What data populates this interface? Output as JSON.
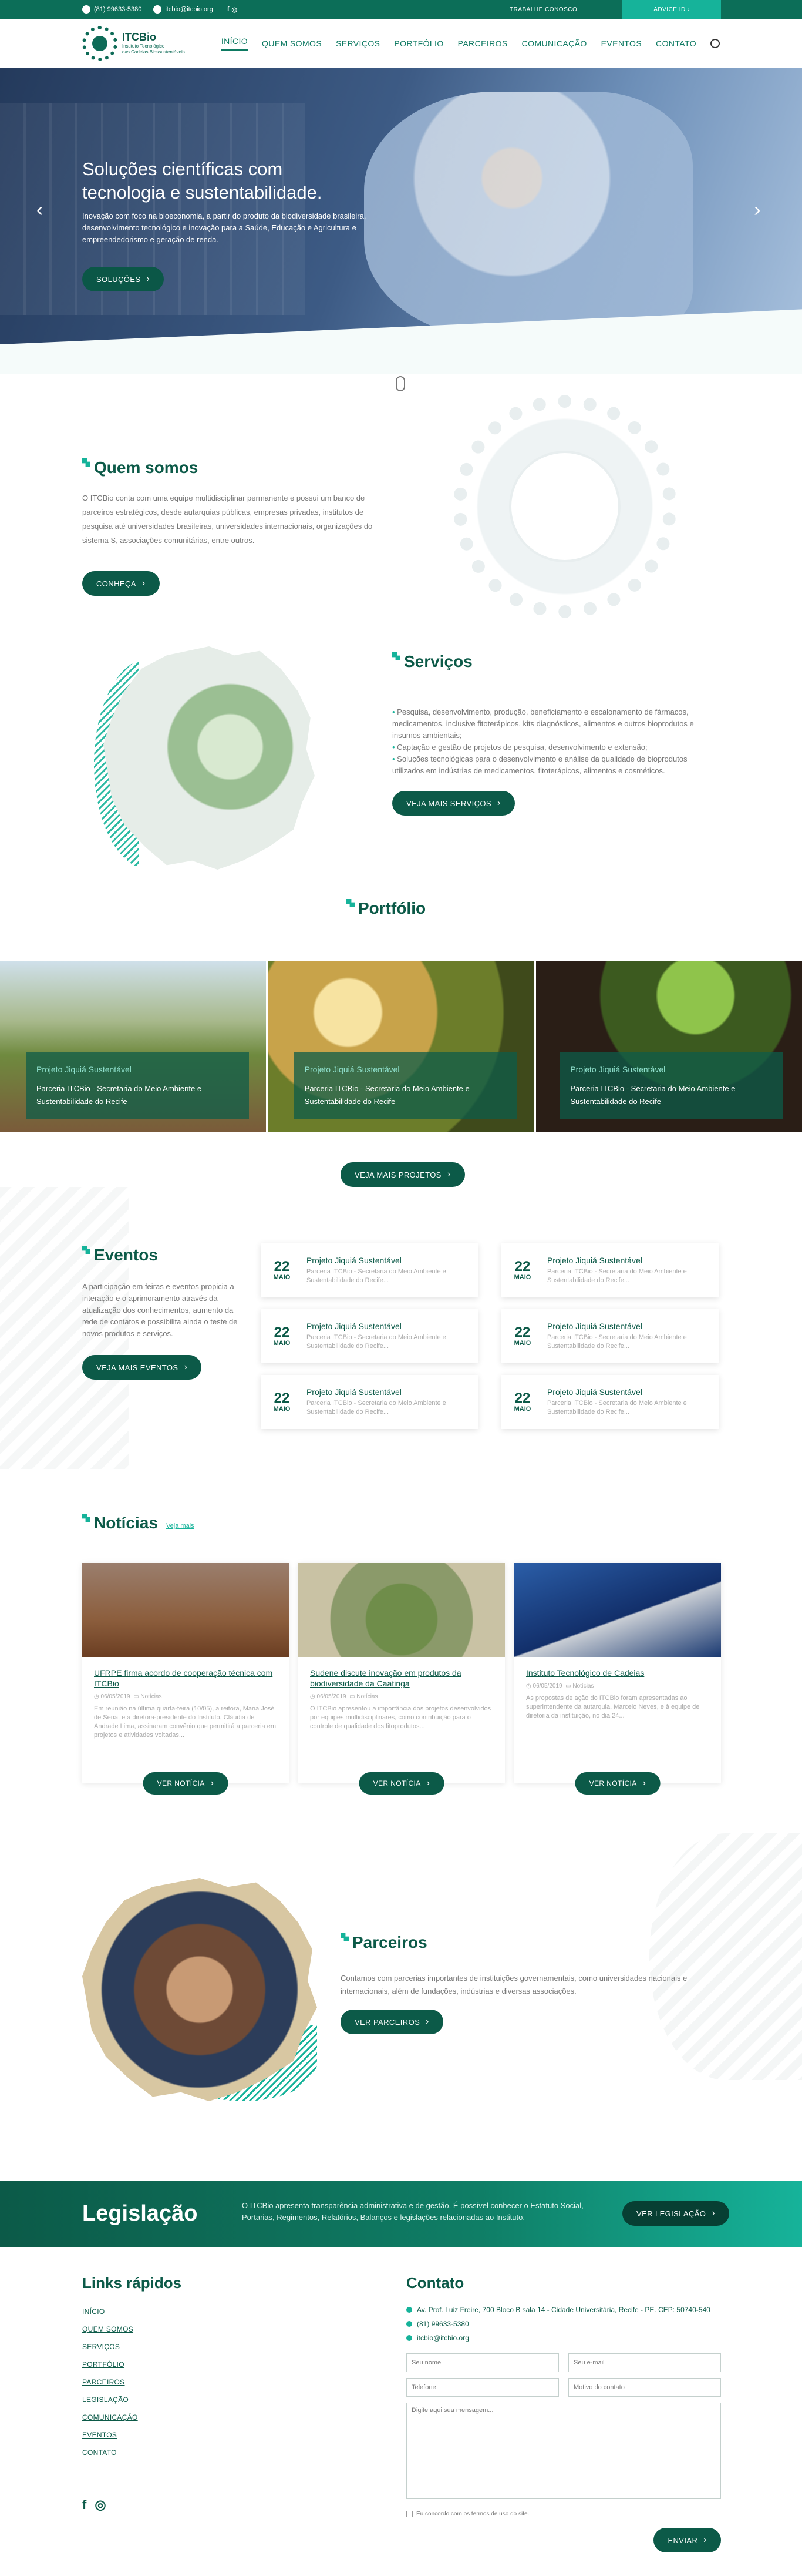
{
  "topbar": {
    "phone": "(81) 99633-5380",
    "email": "itcbio@itcbio.org",
    "work_with_us": "TRABALHE CONOSCO",
    "advice": "ADVICE ID ›"
  },
  "brand": {
    "name": "ITCBio",
    "tagline_1": "Instituto Tecnológico",
    "tagline_2": "das Cadeias Biossustentáveis"
  },
  "nav": {
    "items": [
      "INÍCIO",
      "QUEM SOMOS",
      "SERVIÇOS",
      "PORTFÓLIO",
      "PARCEIROS",
      "COMUNICAÇÃO",
      "EVENTOS",
      "CONTATO"
    ],
    "active": 0
  },
  "hero": {
    "title": "Soluções científicas com tecnologia e sustentabilidade.",
    "text": "Inovação com foco na bioeconomia, a partir do produto da biodiversidade brasileira, desenvolvimento tecnológico e inovação para a Saúde, Educação e Agricultura e empreendedorismo e geração de renda.",
    "button": "SOLUÇÕES"
  },
  "about": {
    "title": "Quem somos",
    "text": "O ITCBio conta com uma equipe multidisciplinar permanente e possui um banco de parceiros estratégicos, desde autarquias públicas, empresas privadas, institutos de pesquisa até universidades brasileiras, universidades internacionais, organizações do sistema S, associações comunitárias, entre outros.",
    "button": "CONHEÇA"
  },
  "services": {
    "title": "Serviços",
    "items": [
      "Pesquisa, desenvolvimento, produção, beneficiamento e escalonamento de fármacos, medicamentos, inclusive fitoterápicos, kits diagnósticos, alimentos e outros bioprodutos e insumos ambientais;",
      "Captação e gestão de projetos de pesquisa, desenvolvimento e extensão;",
      "Soluções tecnológicas para o desenvolvimento e análise da qualidade de bioprodutos utilizados em indústrias de medicamentos, fitoterápicos, alimentos e cosméticos."
    ],
    "button": "VEJA MAIS SERVIÇOS"
  },
  "portfolio": {
    "title": "Portfólio",
    "items": [
      {
        "title": "Projeto Jiquiá Sustentável",
        "text": "Parceria ITCBio - Secretaria do Meio Ambiente e Sustentabilidade do Recife"
      },
      {
        "title": "Projeto Jiquiá Sustentável",
        "text": "Parceria ITCBio - Secretaria do Meio Ambiente e Sustentabilidade do Recife"
      },
      {
        "title": "Projeto Jiquiá Sustentável",
        "text": "Parceria ITCBio - Secretaria do Meio Ambiente e Sustentabilidade do Recife"
      }
    ],
    "button": "VEJA MAIS PROJETOS"
  },
  "events": {
    "title": "Eventos",
    "text": "A participação em feiras e eventos propicia a interação e o aprimoramento através da atualização dos conhecimentos, aumento da rede de contatos e possibilita ainda o teste de novos produtos e serviços.",
    "button": "VEJA MAIS EVENTOS",
    "items": [
      {
        "day": "22",
        "month": "MAIO",
        "title": "Projeto Jiquiá Sustentável",
        "text": "Parceria ITCBio - Secretaria do Meio Ambiente e Sustentabilidade do Recife..."
      },
      {
        "day": "22",
        "month": "MAIO",
        "title": "Projeto Jiquiá Sustentável",
        "text": "Parceria ITCBio - Secretaria do Meio Ambiente e Sustentabilidade do Recife..."
      },
      {
        "day": "22",
        "month": "MAIO",
        "title": "Projeto Jiquiá Sustentável",
        "text": "Parceria ITCBio - Secretaria do Meio Ambiente e Sustentabilidade do Recife..."
      },
      {
        "day": "22",
        "month": "MAIO",
        "title": "Projeto Jiquiá Sustentável",
        "text": "Parceria ITCBio - Secretaria do Meio Ambiente e Sustentabilidade do Recife..."
      },
      {
        "day": "22",
        "month": "MAIO",
        "title": "Projeto Jiquiá Sustentável",
        "text": "Parceria ITCBio - Secretaria do Meio Ambiente e Sustentabilidade do Recife..."
      },
      {
        "day": "22",
        "month": "MAIO",
        "title": "Projeto Jiquiá Sustentável",
        "text": "Parceria ITCBio - Secretaria do Meio Ambiente e Sustentabilidade do Recife..."
      }
    ]
  },
  "news": {
    "title": "Notícias",
    "more": "Veja mais",
    "button": "VER NOTÍCIA",
    "items": [
      {
        "title": "UFRPE firma acordo de cooperação técnica com ITCBio",
        "date": "06/05/2019",
        "category": "Notícias",
        "text": "Em reunião na última quarta-feira (10/05), a reitora, Maria José de Sena, e a diretora-presidente do Instituto, Cláudia de Andrade Lima, assinaram convênio que permitirá a parceria em projetos e atividades voltadas..."
      },
      {
        "title": "Sudene discute inovação em produtos da biodiversidade da Caatinga",
        "date": "06/05/2019",
        "category": "Notícias",
        "text": "O ITCBio apresentou a importância dos projetos desenvolvidos por equipes multidisciplinares, como contribuição para o controle de qualidade dos fitoprodutos..."
      },
      {
        "title": "Instituto Tecnológico de Cadeias",
        "date": "06/05/2019",
        "category": "Notícias",
        "text": "As propostas de ação do ITCBio foram apresentadas ao superintendente da autarquia, Marcelo Neves, e à equipe de diretoria da instituição, no dia 24..."
      }
    ]
  },
  "partners": {
    "title": "Parceiros",
    "text": "Contamos com parcerias importantes de instituições governamentais, como universidades nacionais e internacionais, além de fundações, indústrias e diversas associações.",
    "button": "VER PARCEIROS"
  },
  "legislation": {
    "title": "Legislação",
    "text": "O ITCBio apresenta transparência administrativa e de gestão. É possível conhecer o Estatuto Social, Portarias, Regimentos, Relatórios, Balanços e legislações relacionadas ao Instituto.",
    "button": "VER LEGISLAÇÃO"
  },
  "quick_links": {
    "title": "Links rápidos",
    "items": [
      "INÍCIO",
      "QUEM SOMOS",
      "SERVIÇOS",
      "PORTFÓLIO",
      "PARCEIROS",
      "LEGISLAÇÃO",
      "COMUNICAÇÃO",
      "EVENTOS",
      "CONTATO"
    ]
  },
  "contact": {
    "title": "Contato",
    "address": "Av. Prof. Luiz Freire, 700 Bloco B sala 14 - Cidade Universitária, Recife - PE. CEP: 50740-540",
    "phone": "(81) 99633-5380",
    "email": "itcbio@itcbio.org",
    "ph_name": "Seu nome",
    "ph_email": "Seu e-mail",
    "ph_phone": "Telefone",
    "ph_reason": "Motivo do contato",
    "ph_message": "Digite aqui sua mensagem...",
    "terms": "Eu concordo com os termos de uso do site.",
    "button": "ENVIAR"
  },
  "colors": {
    "primary": "#0c5a48",
    "accent": "#16b39a"
  }
}
